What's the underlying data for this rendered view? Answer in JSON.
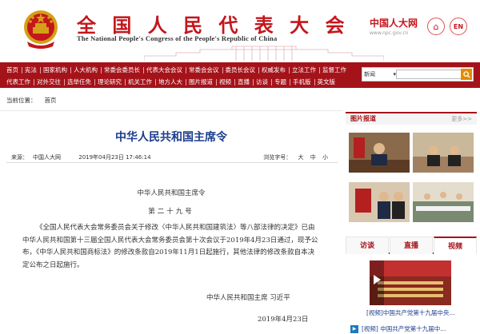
{
  "header": {
    "title_cn": "全 国 人 民 代 表 大 会",
    "title_en": "The National People's Congress of the People's Republic of China",
    "npc_logo_cn": "中国人大网",
    "npc_logo_en": "www.npc.gov.cn",
    "btn_login": "⌂",
    "btn_lang": "EN"
  },
  "nav": {
    "row1": [
      "首页",
      "宪法",
      "国家机构",
      "人大机构",
      "常委会委员长",
      "代表大会会议",
      "常委会会议",
      "委员长会议",
      "权威发布",
      "立法工作",
      "监督工作"
    ],
    "row2": [
      "代表工作",
      "对外交往",
      "选举任免",
      "理论研究",
      "机关工作",
      "地方人大",
      "图片报道",
      "视频",
      "直播",
      "访谈",
      "专题",
      "手机版",
      "英文版"
    ],
    "search_select": "新闻",
    "search_placeholder": "",
    "search_icon": "search-icon"
  },
  "breadcrumb": {
    "label": "当前位置：",
    "home": "首页"
  },
  "article": {
    "title": "中华人民共和国主席令",
    "source_label": "来源：",
    "source": "中国人大网",
    "datetime": "2019年04月23日  17:46:14",
    "fontsize_label": "浏览字号：",
    "font_large": "大",
    "font_medium": "中",
    "font_small": "小",
    "doc_title": "中华人民共和国主席令",
    "doc_num": "第二十九号",
    "body": "《全国人民代表大会常务委员会关于修改〈中华人民共和国建筑法〉等八部法律的决定》已由中华人民共和国第十三届全国人民代表大会常务委员会第十次会议于2019年4月23日通过，现予公布，《中华人民共和国商标法》的修改条款自2019年11月1日起施行，其他法律的修改条款自本决定公布之日起施行。",
    "signature": "中华人民共和国主席  习近平",
    "sign_date": "2019年4月23日"
  },
  "sidebar": {
    "photo_title": "图片报道",
    "more": "更多>>",
    "tabs": [
      "访谈",
      "直播",
      "视频"
    ],
    "active_tab": "视频",
    "video_caption": "[视频]中国共产党第十九届中央...",
    "video_caption2": "[视频] 中国共产党第十九届中..."
  },
  "colors": {
    "brand_red": "#a5131a",
    "title_red": "#c4161c",
    "link_blue": "#1a3c8c"
  }
}
